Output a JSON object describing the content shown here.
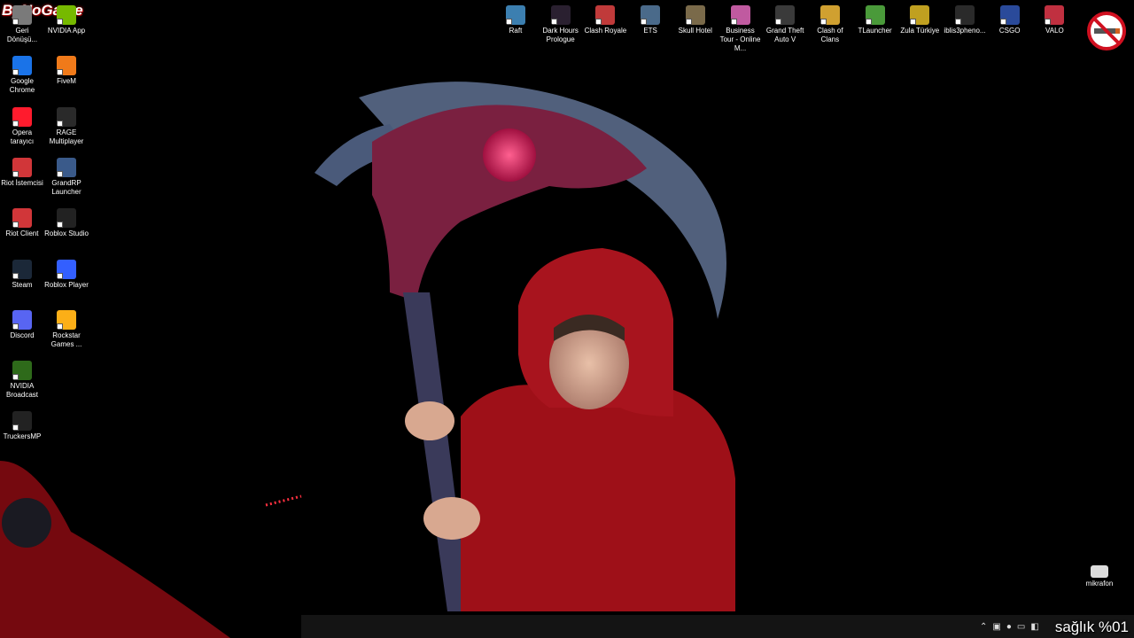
{
  "overlay": {
    "watermark": "ByNoGame",
    "health": "sağlık %01"
  },
  "left_icons": [
    {
      "label": "Geri Dönüşü...",
      "color": "#7a7a7a"
    },
    {
      "label": "NVIDIA App",
      "color": "#76b900"
    },
    {
      "label": "Google Chrome",
      "color": "#1a73e8"
    },
    {
      "label": "FiveM",
      "color": "#f07a1a"
    },
    {
      "label": "Opera tarayıcı",
      "color": "#ff1b2d"
    },
    {
      "label": "RAGE Multiplayer",
      "color": "#2a2a2a"
    },
    {
      "label": "Riot İstemcisi",
      "color": "#d13639"
    },
    {
      "label": "GrandRP Launcher",
      "color": "#3a5a8a"
    },
    {
      "label": "Riot Client",
      "color": "#d13639"
    },
    {
      "label": "Roblox Studio",
      "color": "#222222"
    },
    {
      "label": "Steam",
      "color": "#1b2838"
    },
    {
      "label": "Roblox Player",
      "color": "#335fff"
    },
    {
      "label": "Discord",
      "color": "#5865f2"
    },
    {
      "label": "Rockstar Games ...",
      "color": "#fcaf17"
    },
    {
      "label": "NVIDIA Broadcast",
      "color": "#2e6a1a"
    },
    {
      "label": "TruckersMP",
      "color": "#222222"
    }
  ],
  "top_icons": [
    {
      "label": "Raft",
      "color": "#3c7fb0"
    },
    {
      "label": "Dark Hours Prologue",
      "color": "#2a2030"
    },
    {
      "label": "Clash Royale",
      "color": "#c03a3a"
    },
    {
      "label": "ETS",
      "color": "#4a6a8a"
    },
    {
      "label": "Skull Hotel",
      "color": "#7a6a4a"
    },
    {
      "label": "Business Tour - Online M...",
      "color": "#c05aa0"
    },
    {
      "label": "Grand Theft Auto V",
      "color": "#3a3a3a"
    },
    {
      "label": "Clash of Clans",
      "color": "#d0a030"
    },
    {
      "label": "TLauncher",
      "color": "#4a9a3a"
    },
    {
      "label": "Zula Türkiye",
      "color": "#c0a020"
    },
    {
      "label": "iblis3pheno...",
      "color": "#2a2a2a"
    },
    {
      "label": "CSGO",
      "color": "#2a4a9a"
    },
    {
      "label": "VALO",
      "color": "#c03040"
    }
  ],
  "bottom_right_icon": {
    "label": "mikrafon",
    "color": "#dddddd"
  },
  "colors": {
    "hoodie": "#9e1018",
    "scythe_blade": "#5a6a8a",
    "scythe_head": "#7a2040",
    "background": "#000000"
  }
}
